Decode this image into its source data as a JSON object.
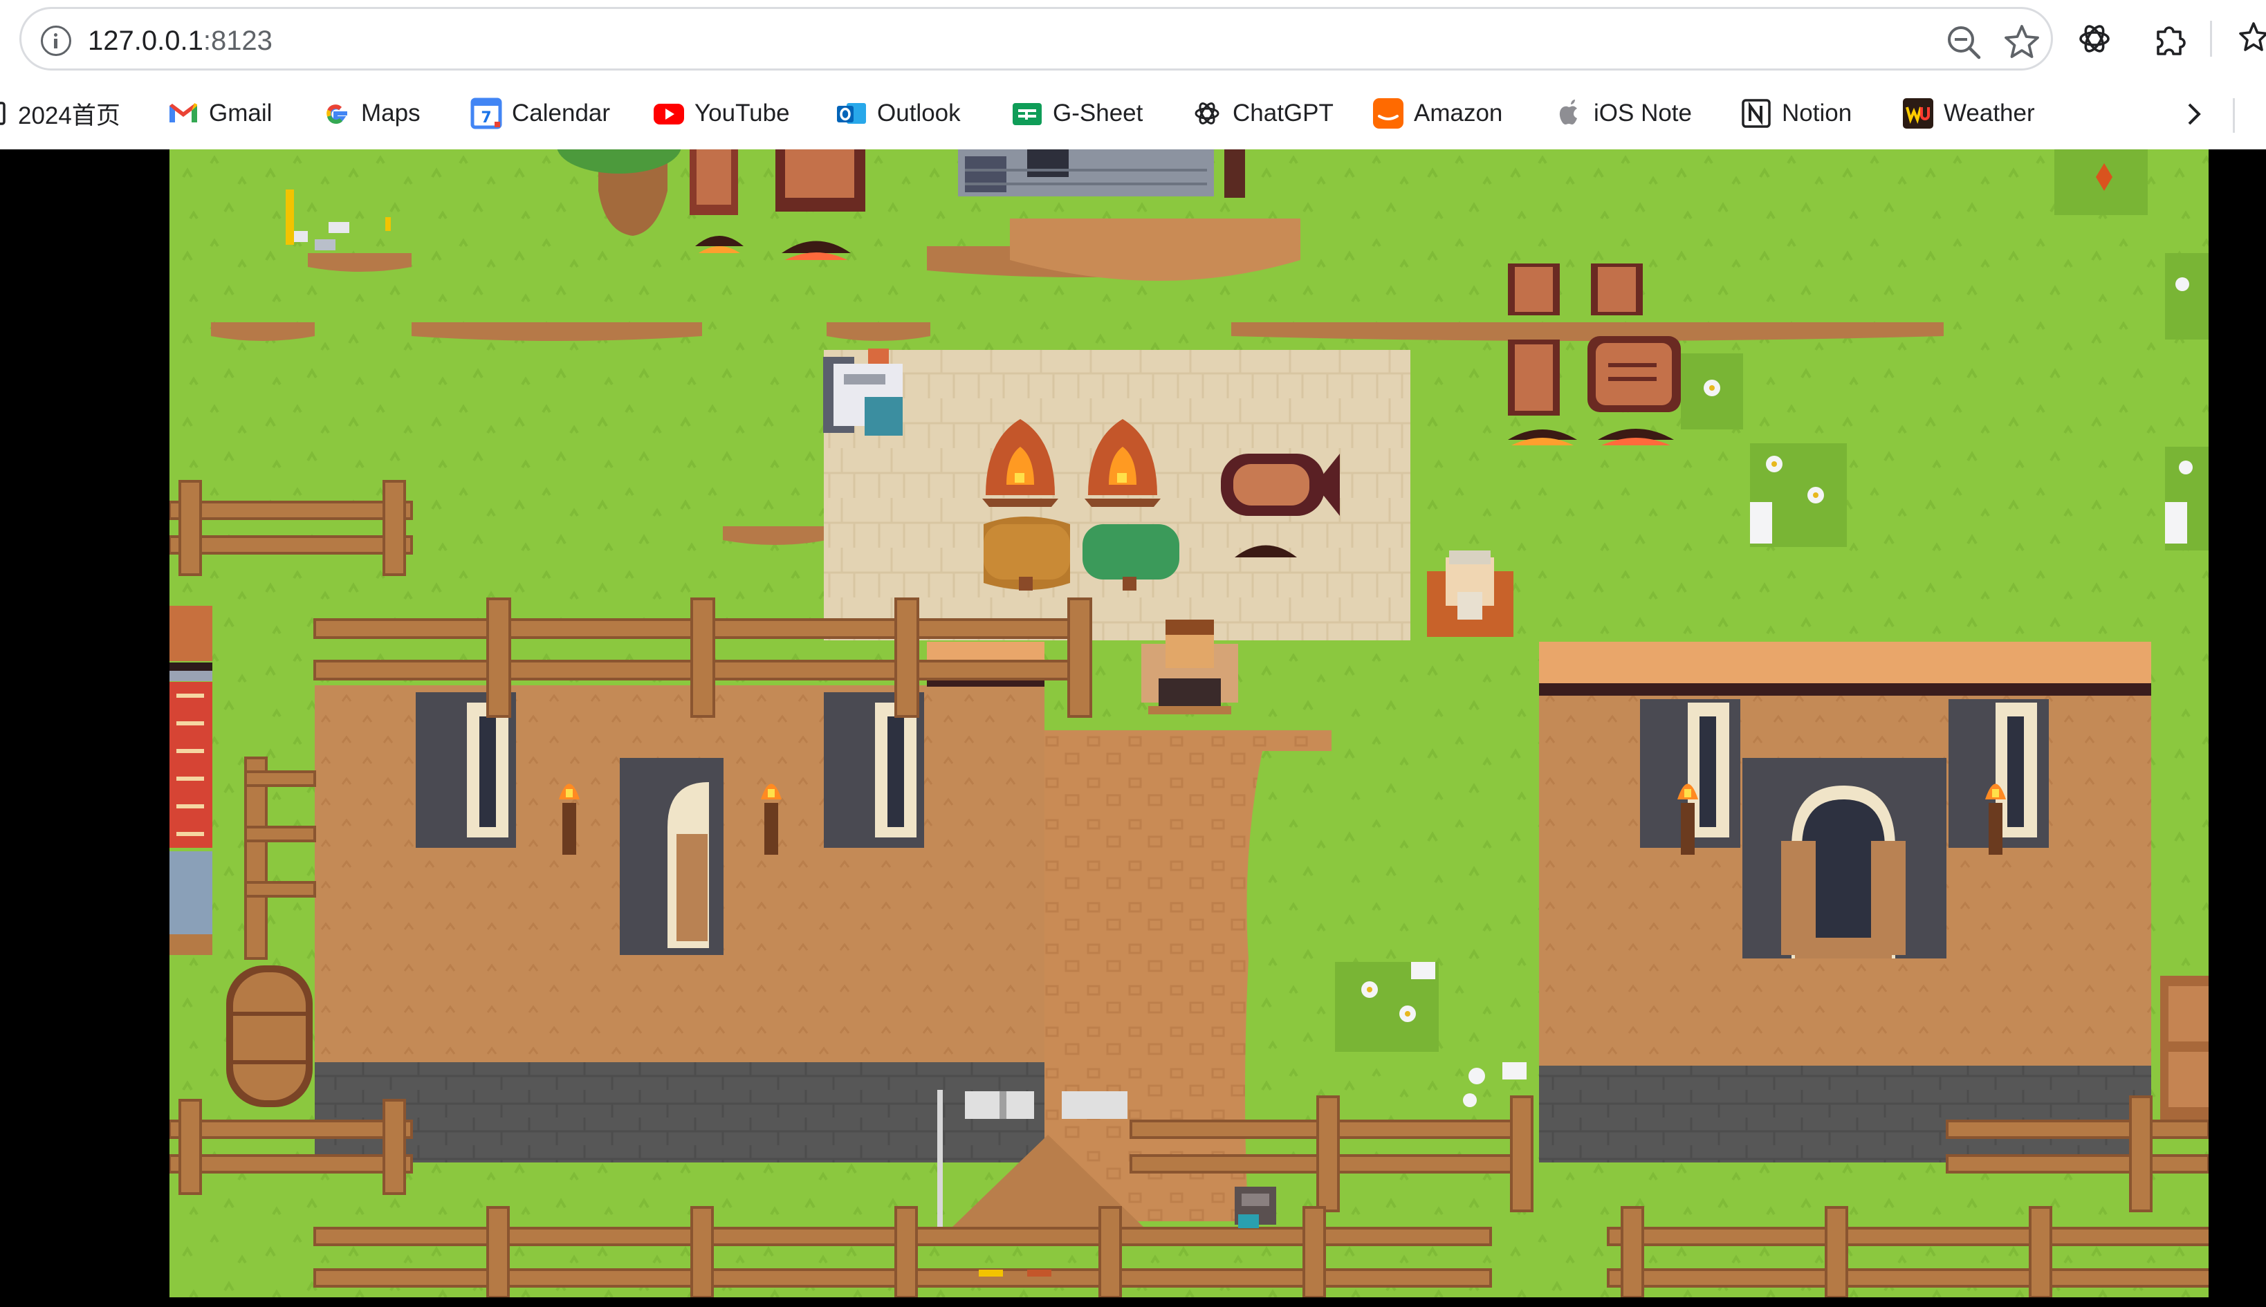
{
  "browser": {
    "url_host": "127.0.0.1",
    "url_port": ":8123",
    "bookmarks": [
      {
        "label": "2024首页",
        "icon": "folder-icon"
      },
      {
        "label": "Gmail",
        "icon": "gmail-icon"
      },
      {
        "label": "Maps",
        "icon": "google-icon"
      },
      {
        "label": "Calendar",
        "icon": "calendar-icon"
      },
      {
        "label": "YouTube",
        "icon": "youtube-icon"
      },
      {
        "label": "Outlook",
        "icon": "outlook-icon"
      },
      {
        "label": "G-Sheet",
        "icon": "sheets-icon"
      },
      {
        "label": "ChatGPT",
        "icon": "chatgpt-icon"
      },
      {
        "label": "Amazon",
        "icon": "amazon-icon"
      },
      {
        "label": "iOS Note",
        "icon": "apple-icon"
      },
      {
        "label": "Notion",
        "icon": "notion-icon"
      },
      {
        "label": "Weather",
        "icon": "weather-icon"
      }
    ],
    "calendar_icon_day": "7"
  },
  "colors": {
    "grass": "#8bc83f",
    "dirt": "#c98b55",
    "plaza": "#e3d3b3",
    "wood": "#b57a45",
    "roof": "#c48a56",
    "stone_wall": "#575757",
    "bg": "#000000"
  }
}
